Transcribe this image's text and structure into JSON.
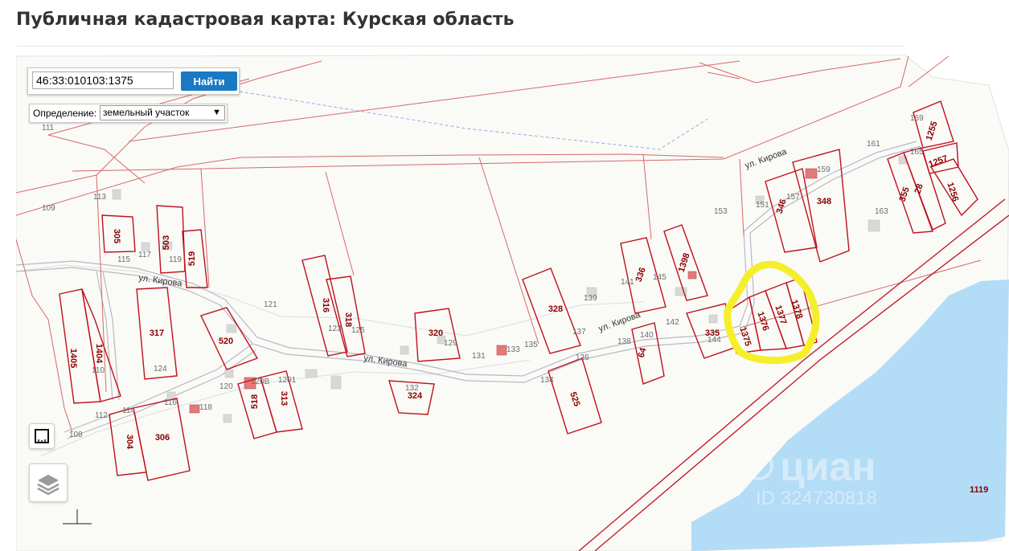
{
  "page": {
    "title": "Публичная кадастровая карта: Курская область"
  },
  "search": {
    "value": "46:33:010103:1375",
    "button_label": "Найти"
  },
  "definition": {
    "label": "Определение:",
    "selected": "земельный участок"
  },
  "streets": [
    "ул. Кирова",
    "ул. Кирова",
    "ул. Кирова",
    "ул. Кирова"
  ],
  "parcels": [
    "305",
    "503",
    "519",
    "317",
    "1405",
    "1404",
    "520",
    "316",
    "318",
    "320",
    "324",
    "328",
    "336",
    "1398",
    "335",
    "1375",
    "1376",
    "1377",
    "1378",
    "346",
    "348",
    "355",
    "28",
    "1256",
    "1257",
    "1255",
    "304",
    "306",
    "518",
    "313",
    "525",
    "64"
  ],
  "buildings": [
    "111",
    "113",
    "109",
    "115",
    "117",
    "119",
    "121",
    "123",
    "125",
    "110",
    "124",
    "120",
    "108",
    "114",
    "112",
    "116",
    "118",
    "120В",
    "1201",
    "131",
    "129",
    "133",
    "135",
    "132",
    "134",
    "136",
    "137",
    "139",
    "141",
    "145",
    "138",
    "140",
    "142",
    "144",
    "151",
    "153",
    "157",
    "159",
    "161",
    "163",
    "165",
    "169"
  ],
  "area_label": "1119",
  "watermark": {
    "brand": "циан",
    "id": "ID 324730818"
  },
  "colors": {
    "parcel": "#c0101a",
    "water": "#b3dcf6",
    "highlight": "#f4ef2a",
    "button": "#1a79c2"
  }
}
